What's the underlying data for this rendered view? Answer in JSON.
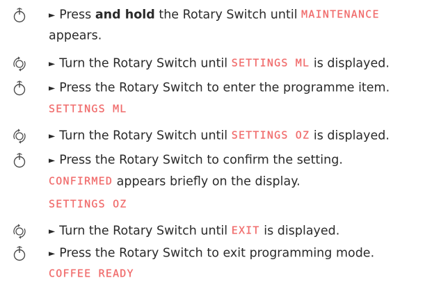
{
  "steps": [
    {
      "icon": "press-icon",
      "type": "text",
      "parts": [
        "Press ",
        "and hold",
        " the Rotary Switch until ",
        "MAINTENANCE"
      ]
    },
    {
      "icon": "none",
      "type": "text",
      "parts": [
        "appears."
      ]
    },
    {
      "icon": "turn-icon",
      "type": "text",
      "parts": [
        "Turn the Rotary Switch until ",
        "SETTINGS ML",
        " is displayed."
      ]
    },
    {
      "icon": "press-icon",
      "type": "text",
      "parts": [
        "Press the Rotary Switch to enter the programme item."
      ]
    },
    {
      "icon": "none",
      "type": "display",
      "parts": [
        "SETTINGS ML"
      ]
    },
    {
      "icon": "turn-icon",
      "type": "text",
      "parts": [
        "Turn the Rotary Switch until ",
        "SETTINGS OZ",
        " is displayed."
      ]
    },
    {
      "icon": "press-icon",
      "type": "text",
      "parts": [
        "Press the Rotary Switch to confirm the setting."
      ]
    },
    {
      "icon": "none",
      "type": "text",
      "parts": [
        "CONFIRMED",
        " appears briefly on the display."
      ]
    },
    {
      "icon": "none",
      "type": "display",
      "parts": [
        "SETTINGS OZ"
      ]
    },
    {
      "icon": "turn-icon",
      "type": "text",
      "parts": [
        "Turn the Rotary Switch until ",
        "EXIT",
        " is displayed."
      ]
    },
    {
      "icon": "press-icon",
      "type": "text",
      "parts": [
        "Press the Rotary Switch to exit programming mode."
      ]
    },
    {
      "icon": "none",
      "type": "display",
      "parts": [
        "COFFEE READY"
      ]
    }
  ],
  "arrow_glyph": "►",
  "colors": {
    "display_text": "#f06a6a",
    "icon": "#4a4a4a",
    "body_text": "#2a2a2a"
  }
}
